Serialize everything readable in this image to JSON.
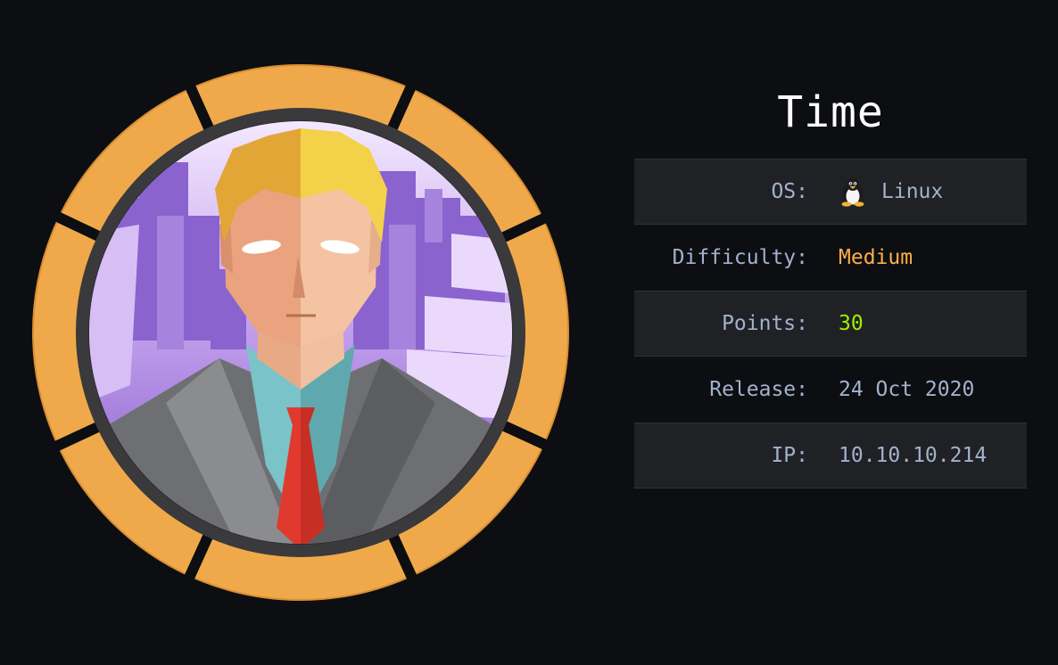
{
  "machine": {
    "name": "Time",
    "os_label": "OS:",
    "os": "Linux",
    "os_icon": "tux-penguin-icon",
    "difficulty_label": "Difficulty:",
    "difficulty": "Medium",
    "points_label": "Points:",
    "points": "30",
    "release_label": "Release:",
    "release": "24 Oct 2020",
    "ip_label": "IP:",
    "ip": "10.10.10.214"
  },
  "colors": {
    "background": "#0c0e11",
    "ring": "#f0a94a",
    "medium": "#ffaf4a",
    "points": "#9fef00",
    "label": "#a4b1cd"
  }
}
